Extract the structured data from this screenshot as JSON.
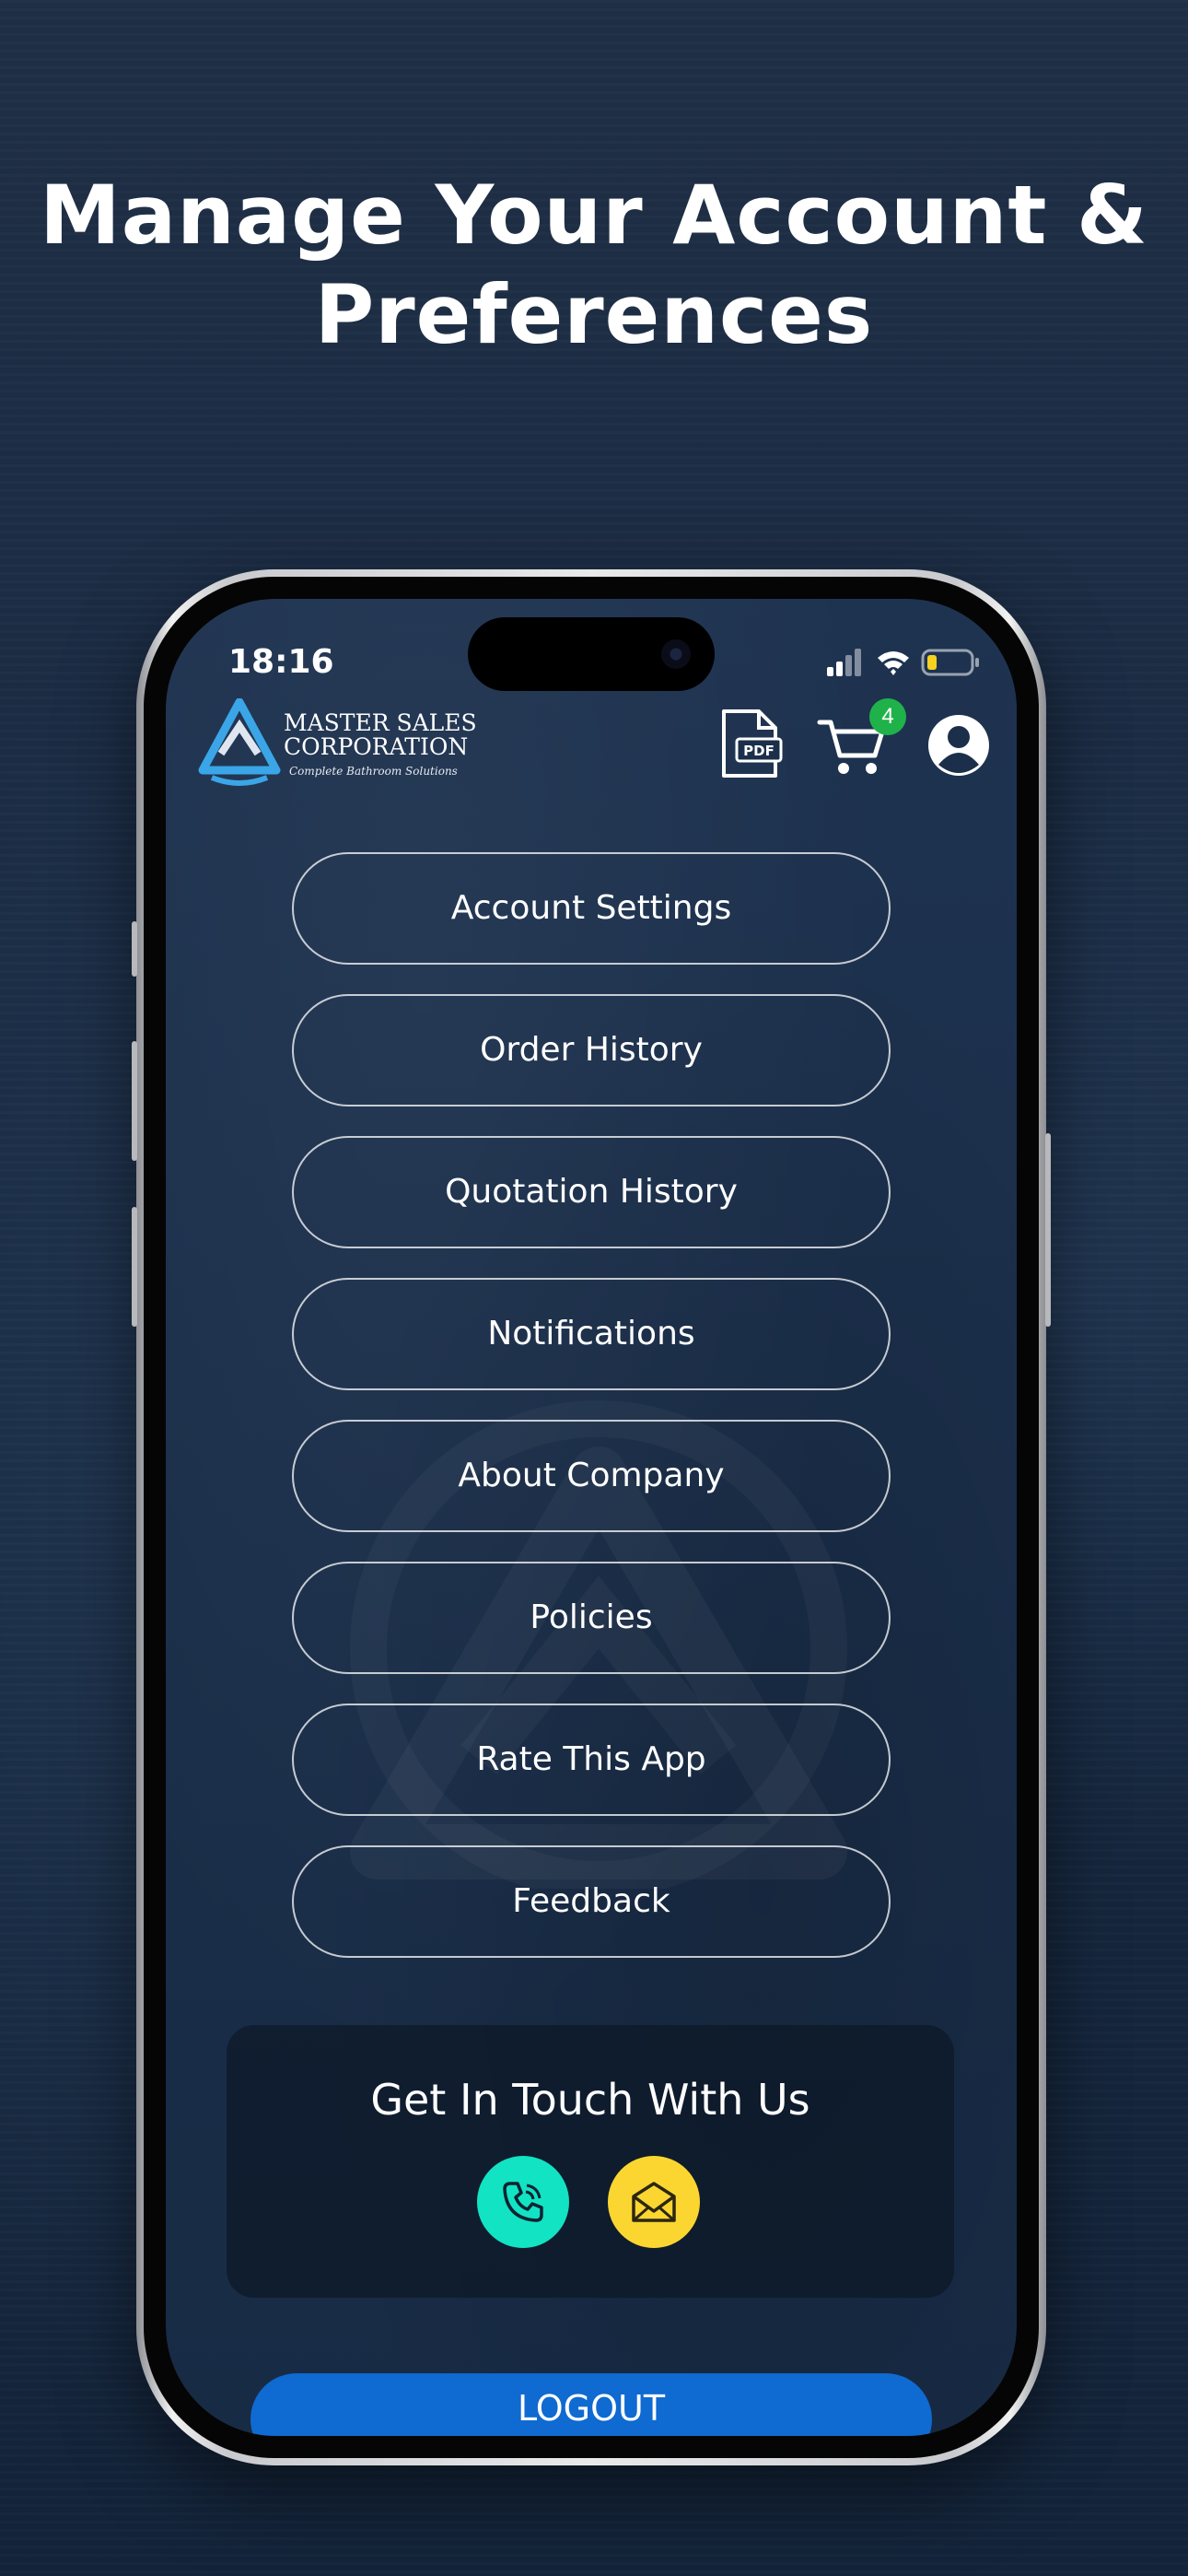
{
  "headline": {
    "line1": "Manage Your Account &",
    "line2": "Preferences"
  },
  "status_bar": {
    "time": "18:16",
    "icons": [
      "cellular-signal-icon",
      "wifi-icon",
      "battery-icon"
    ]
  },
  "header": {
    "logo": {
      "line1": "MASTER SALES",
      "line2": "CORPORATION",
      "tagline": "Complete Bathroom Solutions"
    },
    "pdf_label": "PDF",
    "cart_count": "4",
    "icons": [
      "pdf-icon",
      "cart-icon",
      "profile-icon"
    ]
  },
  "menu": {
    "items": [
      {
        "label": "Account Settings"
      },
      {
        "label": "Order History"
      },
      {
        "label": "Quotation History"
      },
      {
        "label": "Notifications"
      },
      {
        "label": "About Company"
      },
      {
        "label": "Policies"
      },
      {
        "label": "Rate This App"
      },
      {
        "label": "Feedback"
      }
    ]
  },
  "contact": {
    "title": "Get In Touch With Us",
    "buttons": [
      {
        "icon": "phone-icon",
        "color": "#12e3c2"
      },
      {
        "icon": "mail-icon",
        "color": "#fbd631"
      }
    ]
  },
  "logout": {
    "label": "LOGOUT",
    "color": "#0f6ad1"
  },
  "colors": {
    "background": "#1b2c44",
    "badge": "#20b24a",
    "logo_blue": "#3aa6e8"
  }
}
